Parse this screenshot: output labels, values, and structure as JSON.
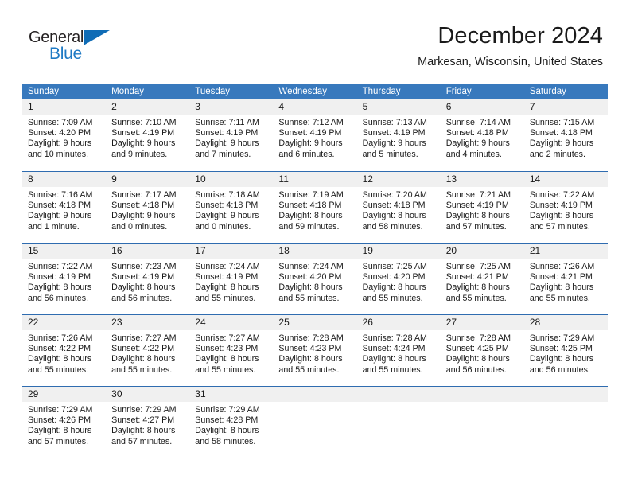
{
  "logo": {
    "text_primary": "General",
    "text_secondary": "Blue",
    "icon": "triangle-flag-icon",
    "color_primary": "#231f20",
    "color_secondary": "#1f7ac4"
  },
  "header": {
    "month_title": "December 2024",
    "location": "Markesan, Wisconsin, United States"
  },
  "theme": {
    "header_blue": "#3879bd",
    "row_divider_blue": "#2f6cb0",
    "day_band_gray": "#f0f0f0",
    "text_color": "#1a1a1a"
  },
  "weekdays": [
    "Sunday",
    "Monday",
    "Tuesday",
    "Wednesday",
    "Thursday",
    "Friday",
    "Saturday"
  ],
  "weeks": [
    [
      {
        "day": "1",
        "sunrise": "Sunrise: 7:09 AM",
        "sunset": "Sunset: 4:20 PM",
        "daylight_1": "Daylight: 9 hours",
        "daylight_2": "and 10 minutes."
      },
      {
        "day": "2",
        "sunrise": "Sunrise: 7:10 AM",
        "sunset": "Sunset: 4:19 PM",
        "daylight_1": "Daylight: 9 hours",
        "daylight_2": "and 9 minutes."
      },
      {
        "day": "3",
        "sunrise": "Sunrise: 7:11 AM",
        "sunset": "Sunset: 4:19 PM",
        "daylight_1": "Daylight: 9 hours",
        "daylight_2": "and 7 minutes."
      },
      {
        "day": "4",
        "sunrise": "Sunrise: 7:12 AM",
        "sunset": "Sunset: 4:19 PM",
        "daylight_1": "Daylight: 9 hours",
        "daylight_2": "and 6 minutes."
      },
      {
        "day": "5",
        "sunrise": "Sunrise: 7:13 AM",
        "sunset": "Sunset: 4:19 PM",
        "daylight_1": "Daylight: 9 hours",
        "daylight_2": "and 5 minutes."
      },
      {
        "day": "6",
        "sunrise": "Sunrise: 7:14 AM",
        "sunset": "Sunset: 4:18 PM",
        "daylight_1": "Daylight: 9 hours",
        "daylight_2": "and 4 minutes."
      },
      {
        "day": "7",
        "sunrise": "Sunrise: 7:15 AM",
        "sunset": "Sunset: 4:18 PM",
        "daylight_1": "Daylight: 9 hours",
        "daylight_2": "and 2 minutes."
      }
    ],
    [
      {
        "day": "8",
        "sunrise": "Sunrise: 7:16 AM",
        "sunset": "Sunset: 4:18 PM",
        "daylight_1": "Daylight: 9 hours",
        "daylight_2": "and 1 minute."
      },
      {
        "day": "9",
        "sunrise": "Sunrise: 7:17 AM",
        "sunset": "Sunset: 4:18 PM",
        "daylight_1": "Daylight: 9 hours",
        "daylight_2": "and 0 minutes."
      },
      {
        "day": "10",
        "sunrise": "Sunrise: 7:18 AM",
        "sunset": "Sunset: 4:18 PM",
        "daylight_1": "Daylight: 9 hours",
        "daylight_2": "and 0 minutes."
      },
      {
        "day": "11",
        "sunrise": "Sunrise: 7:19 AM",
        "sunset": "Sunset: 4:18 PM",
        "daylight_1": "Daylight: 8 hours",
        "daylight_2": "and 59 minutes."
      },
      {
        "day": "12",
        "sunrise": "Sunrise: 7:20 AM",
        "sunset": "Sunset: 4:18 PM",
        "daylight_1": "Daylight: 8 hours",
        "daylight_2": "and 58 minutes."
      },
      {
        "day": "13",
        "sunrise": "Sunrise: 7:21 AM",
        "sunset": "Sunset: 4:19 PM",
        "daylight_1": "Daylight: 8 hours",
        "daylight_2": "and 57 minutes."
      },
      {
        "day": "14",
        "sunrise": "Sunrise: 7:22 AM",
        "sunset": "Sunset: 4:19 PM",
        "daylight_1": "Daylight: 8 hours",
        "daylight_2": "and 57 minutes."
      }
    ],
    [
      {
        "day": "15",
        "sunrise": "Sunrise: 7:22 AM",
        "sunset": "Sunset: 4:19 PM",
        "daylight_1": "Daylight: 8 hours",
        "daylight_2": "and 56 minutes."
      },
      {
        "day": "16",
        "sunrise": "Sunrise: 7:23 AM",
        "sunset": "Sunset: 4:19 PM",
        "daylight_1": "Daylight: 8 hours",
        "daylight_2": "and 56 minutes."
      },
      {
        "day": "17",
        "sunrise": "Sunrise: 7:24 AM",
        "sunset": "Sunset: 4:19 PM",
        "daylight_1": "Daylight: 8 hours",
        "daylight_2": "and 55 minutes."
      },
      {
        "day": "18",
        "sunrise": "Sunrise: 7:24 AM",
        "sunset": "Sunset: 4:20 PM",
        "daylight_1": "Daylight: 8 hours",
        "daylight_2": "and 55 minutes."
      },
      {
        "day": "19",
        "sunrise": "Sunrise: 7:25 AM",
        "sunset": "Sunset: 4:20 PM",
        "daylight_1": "Daylight: 8 hours",
        "daylight_2": "and 55 minutes."
      },
      {
        "day": "20",
        "sunrise": "Sunrise: 7:25 AM",
        "sunset": "Sunset: 4:21 PM",
        "daylight_1": "Daylight: 8 hours",
        "daylight_2": "and 55 minutes."
      },
      {
        "day": "21",
        "sunrise": "Sunrise: 7:26 AM",
        "sunset": "Sunset: 4:21 PM",
        "daylight_1": "Daylight: 8 hours",
        "daylight_2": "and 55 minutes."
      }
    ],
    [
      {
        "day": "22",
        "sunrise": "Sunrise: 7:26 AM",
        "sunset": "Sunset: 4:22 PM",
        "daylight_1": "Daylight: 8 hours",
        "daylight_2": "and 55 minutes."
      },
      {
        "day": "23",
        "sunrise": "Sunrise: 7:27 AM",
        "sunset": "Sunset: 4:22 PM",
        "daylight_1": "Daylight: 8 hours",
        "daylight_2": "and 55 minutes."
      },
      {
        "day": "24",
        "sunrise": "Sunrise: 7:27 AM",
        "sunset": "Sunset: 4:23 PM",
        "daylight_1": "Daylight: 8 hours",
        "daylight_2": "and 55 minutes."
      },
      {
        "day": "25",
        "sunrise": "Sunrise: 7:28 AM",
        "sunset": "Sunset: 4:23 PM",
        "daylight_1": "Daylight: 8 hours",
        "daylight_2": "and 55 minutes."
      },
      {
        "day": "26",
        "sunrise": "Sunrise: 7:28 AM",
        "sunset": "Sunset: 4:24 PM",
        "daylight_1": "Daylight: 8 hours",
        "daylight_2": "and 55 minutes."
      },
      {
        "day": "27",
        "sunrise": "Sunrise: 7:28 AM",
        "sunset": "Sunset: 4:25 PM",
        "daylight_1": "Daylight: 8 hours",
        "daylight_2": "and 56 minutes."
      },
      {
        "day": "28",
        "sunrise": "Sunrise: 7:29 AM",
        "sunset": "Sunset: 4:25 PM",
        "daylight_1": "Daylight: 8 hours",
        "daylight_2": "and 56 minutes."
      }
    ],
    [
      {
        "day": "29",
        "sunrise": "Sunrise: 7:29 AM",
        "sunset": "Sunset: 4:26 PM",
        "daylight_1": "Daylight: 8 hours",
        "daylight_2": "and 57 minutes."
      },
      {
        "day": "30",
        "sunrise": "Sunrise: 7:29 AM",
        "sunset": "Sunset: 4:27 PM",
        "daylight_1": "Daylight: 8 hours",
        "daylight_2": "and 57 minutes."
      },
      {
        "day": "31",
        "sunrise": "Sunrise: 7:29 AM",
        "sunset": "Sunset: 4:28 PM",
        "daylight_1": "Daylight: 8 hours",
        "daylight_2": "and 58 minutes."
      },
      {
        "day": "",
        "sunrise": "",
        "sunset": "",
        "daylight_1": "",
        "daylight_2": ""
      },
      {
        "day": "",
        "sunrise": "",
        "sunset": "",
        "daylight_1": "",
        "daylight_2": ""
      },
      {
        "day": "",
        "sunrise": "",
        "sunset": "",
        "daylight_1": "",
        "daylight_2": ""
      },
      {
        "day": "",
        "sunrise": "",
        "sunset": "",
        "daylight_1": "",
        "daylight_2": ""
      }
    ]
  ]
}
